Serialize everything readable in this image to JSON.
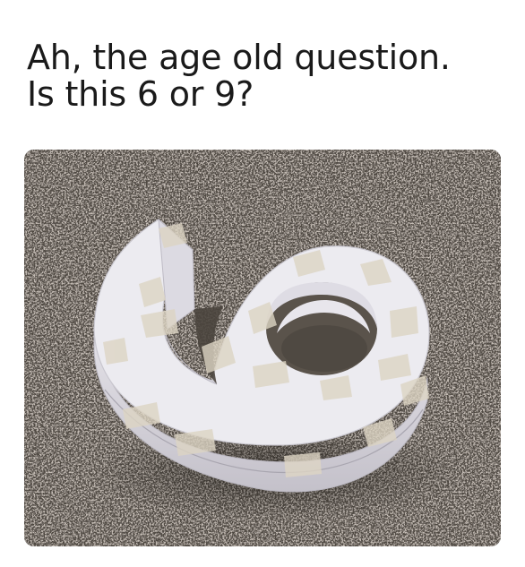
{
  "caption": {
    "line1": "Ah, the age old question.",
    "line2": "Is this 6 or 9?"
  },
  "photo": {
    "subject": "paper-craft-numeral-icon",
    "surface": "granite-countertop-icon"
  },
  "colors": {
    "background": "#ffffff",
    "caption_text": "#1a1a1a",
    "granite_base": "#4e4841",
    "paper": "#ecebf0",
    "paper_shadow": "#c9c7cf",
    "tape": "#ddd5c4"
  }
}
